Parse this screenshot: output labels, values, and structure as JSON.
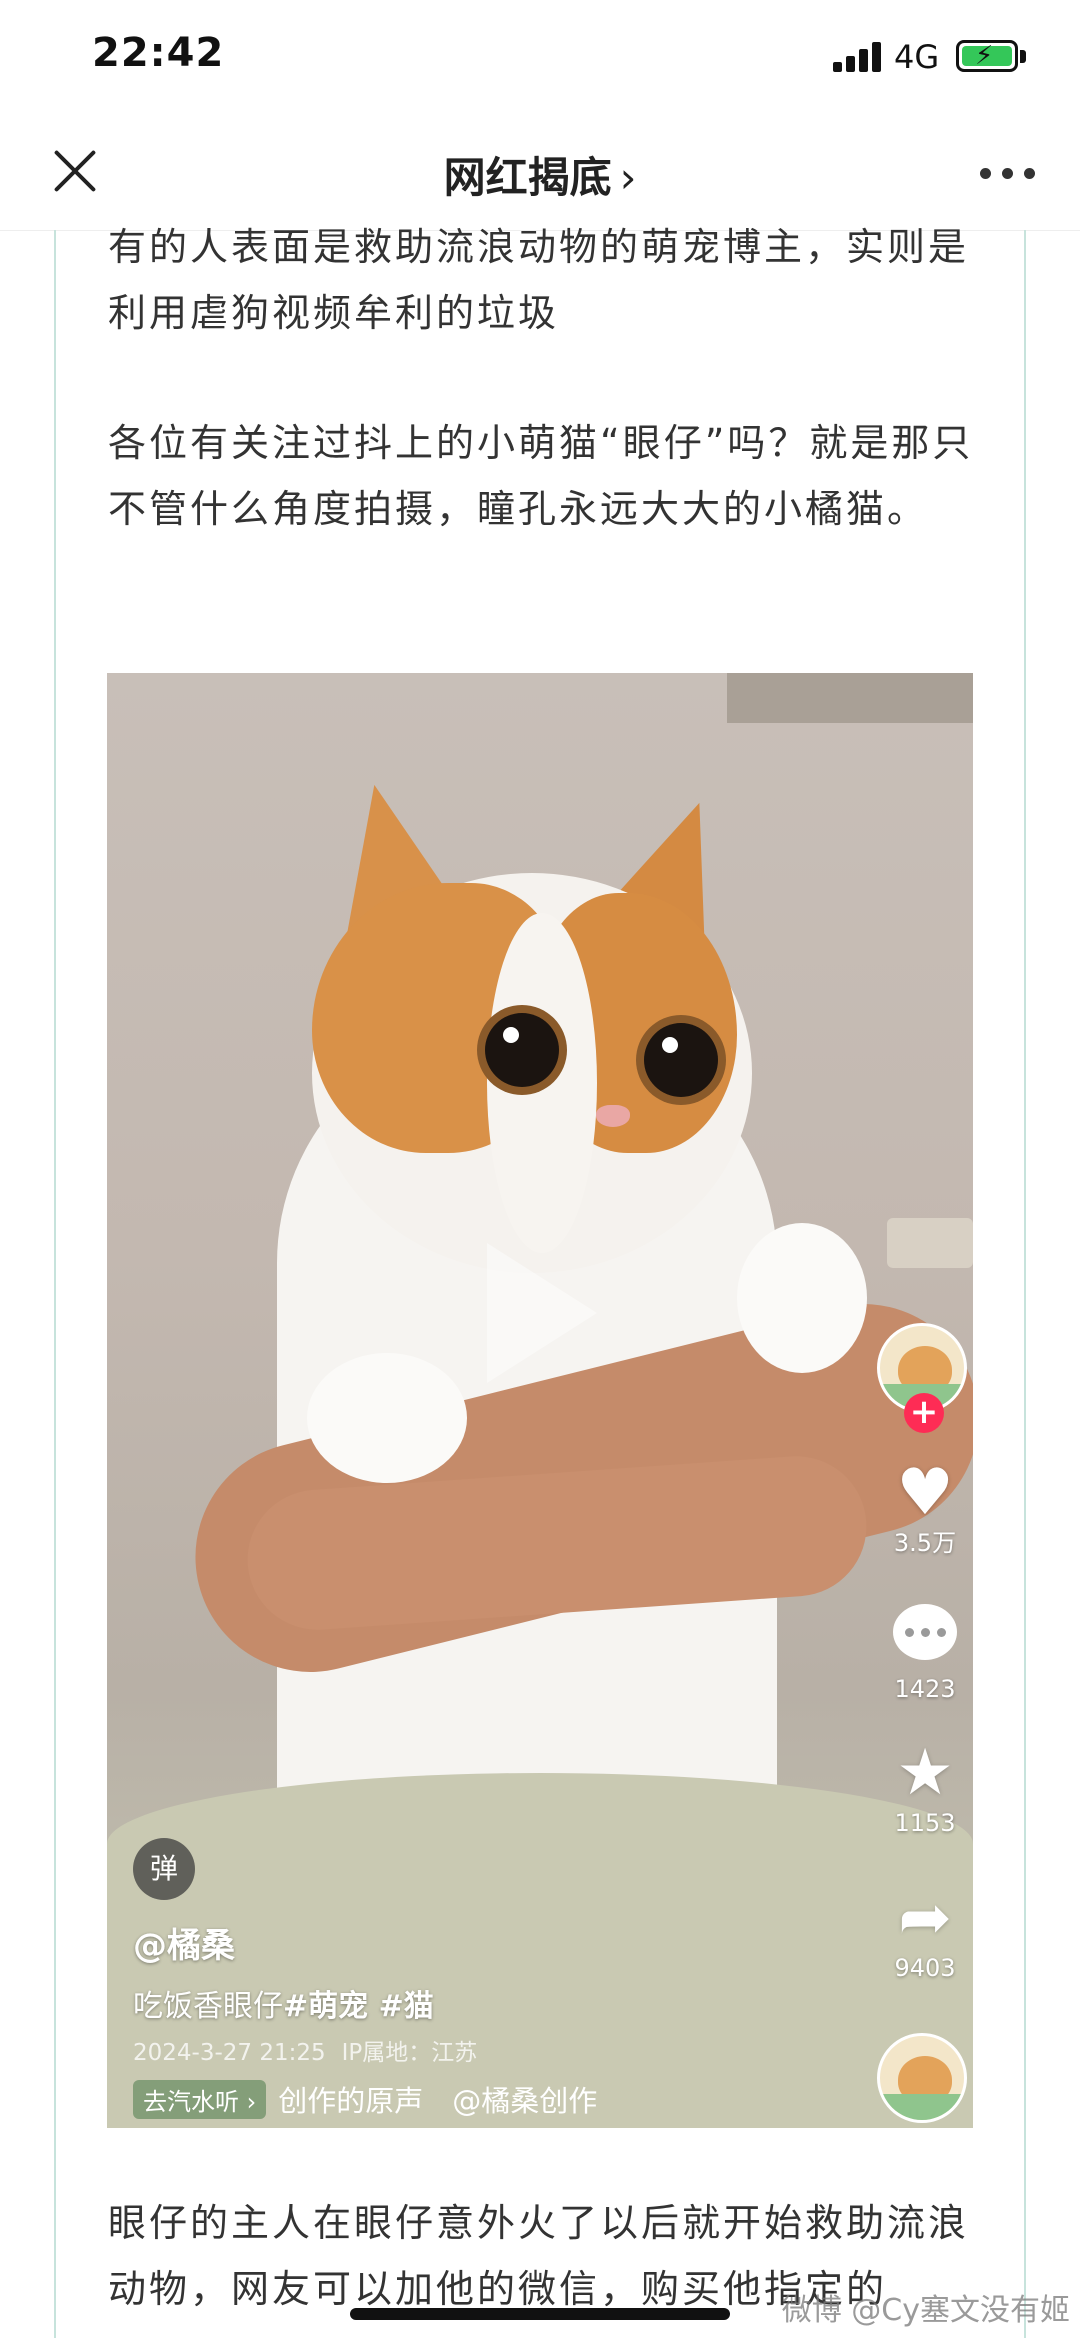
{
  "status_bar": {
    "time": "22:42",
    "network": "4G",
    "battery_charging": true
  },
  "nav": {
    "title": "网红揭底",
    "title_chevron": "›",
    "close_icon": "close-icon",
    "more_icon": "more-icon"
  },
  "article": {
    "para1": "有的人表面是救助流浪动物的萌宠博主，实则是利用虐狗视频牟利的垃圾",
    "para2": "各位有关注过抖上的小萌猫“眼仔”吗？就是那只不管什么角度拍摄，瞳孔永远大大的小橘猫。",
    "para3": "眼仔的主人在眼仔意外火了以后就开始救助流浪动物，网友可以加他的微信，购买他指定的"
  },
  "video": {
    "danmu_label": "弹",
    "author": "@橘桑",
    "caption_plain": "吃饭香眼仔",
    "caption_tags": "#萌宠 #猫",
    "date": "2024-3-27 21:25",
    "ip_location": "IP属地：江苏",
    "go_tag": "去汽水听 ›",
    "music": "创作的原声　@橘桑创作",
    "likes": "3.5万",
    "comments": "1423",
    "favorites": "1153",
    "shares": "9403",
    "follow_symbol": "+"
  },
  "watermark": "微博 @Cy塞文没有姬",
  "colors": {
    "frame_border": "#c7e3dc",
    "follow_badge": "#fe2c55",
    "battery_fill": "#34c759"
  }
}
